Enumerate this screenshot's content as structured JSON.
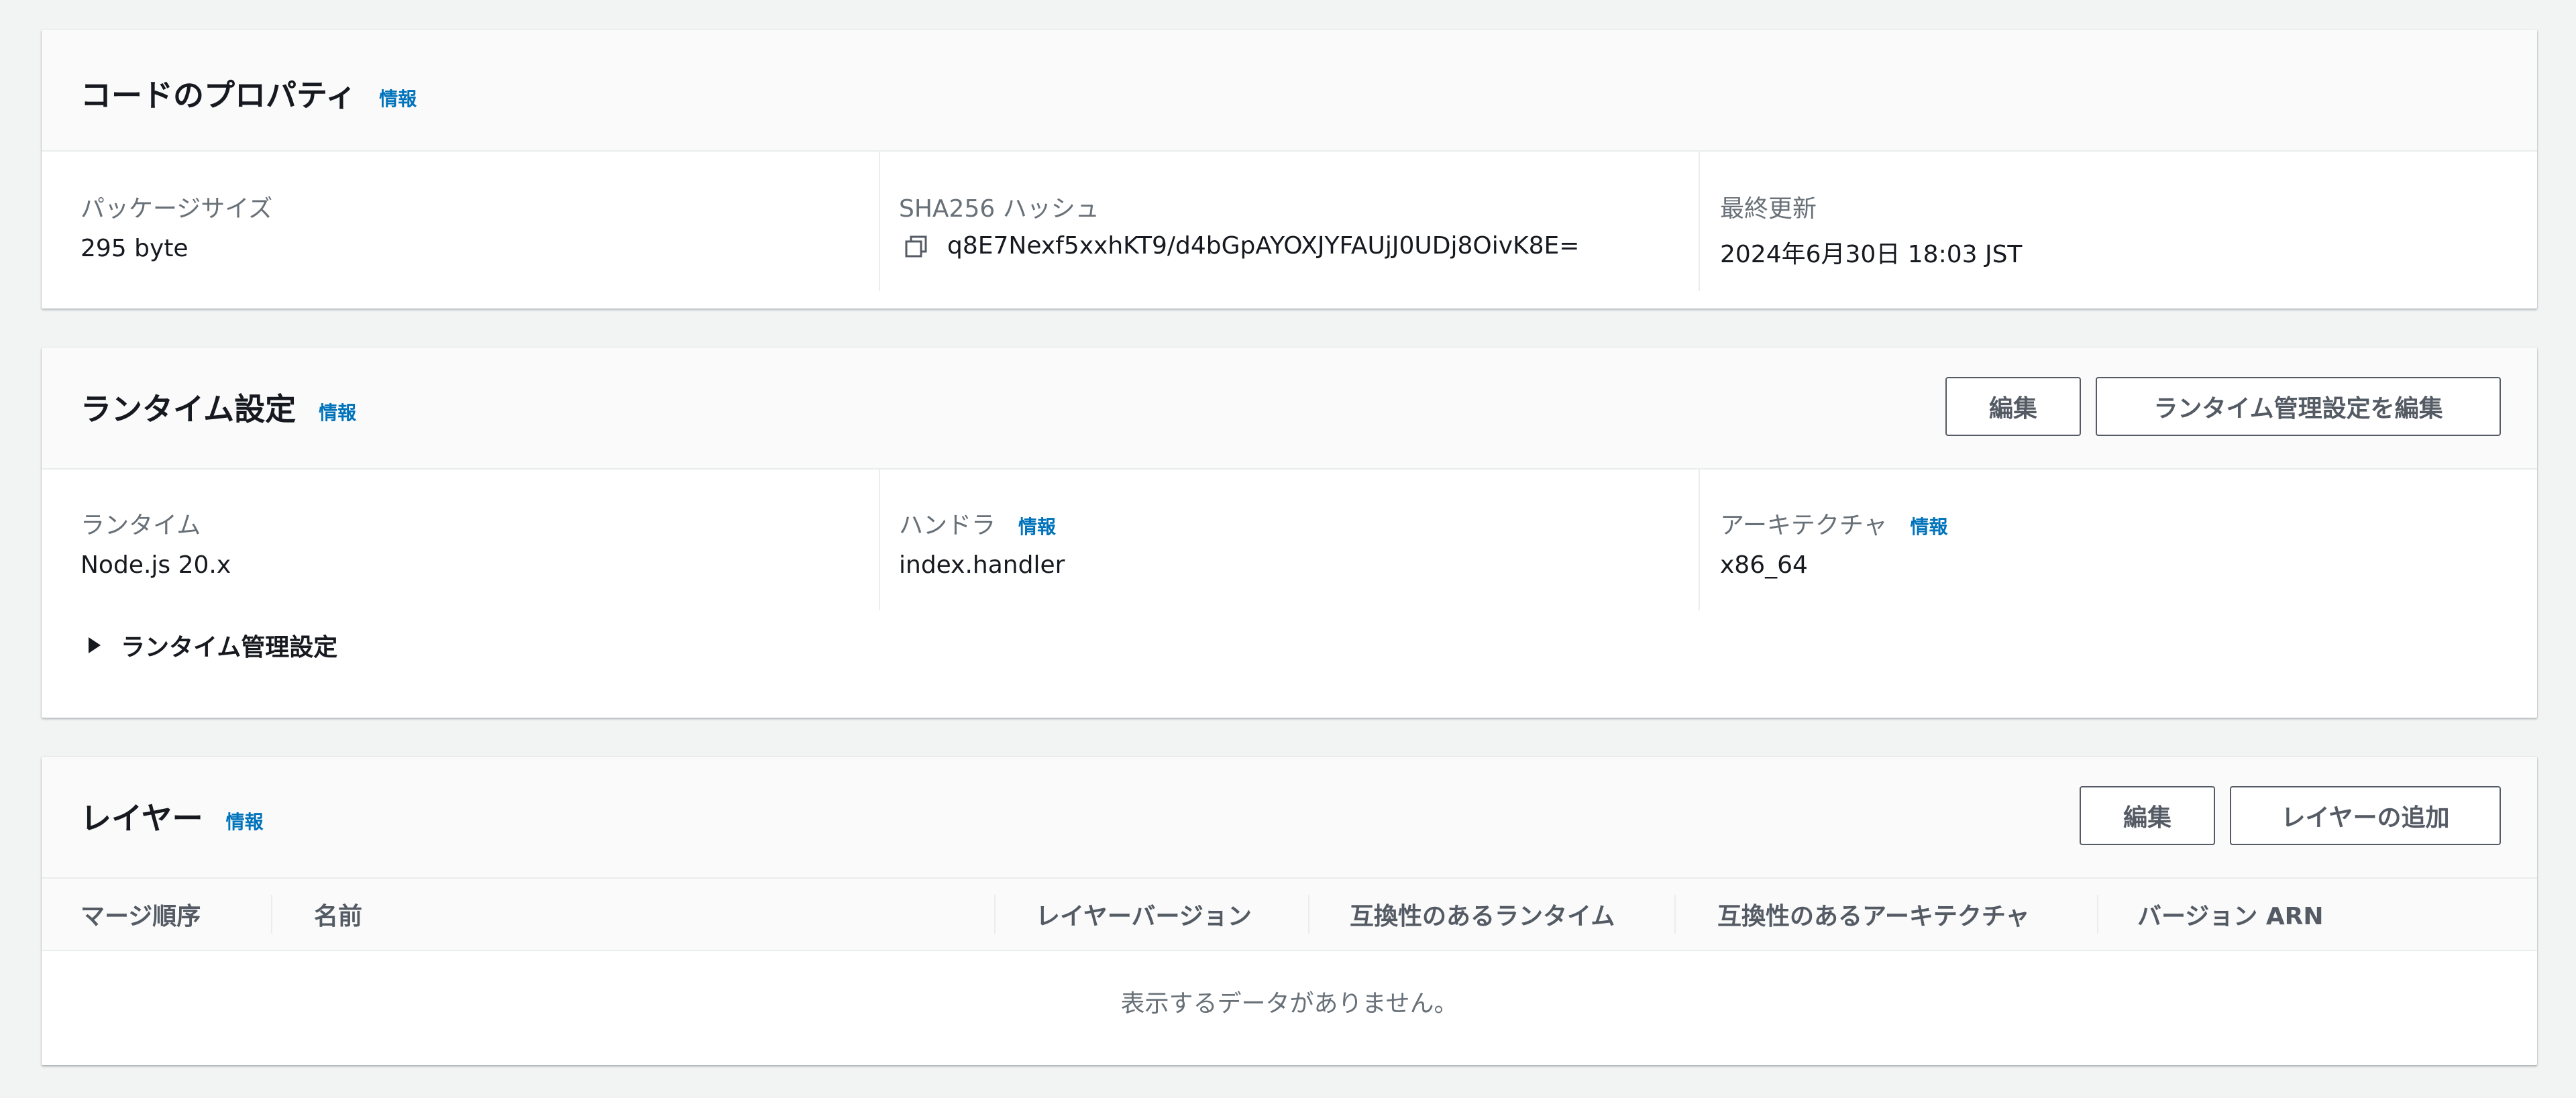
{
  "code_properties": {
    "title": "コードのプロパティ",
    "info": "情報",
    "package_size": {
      "label": "パッケージサイズ",
      "value": "295 byte"
    },
    "sha256": {
      "label": "SHA256 ハッシュ",
      "value": "q8E7Nexf5xxhKT9/d4bGpAYOXJYFAUjJ0UDj8OivK8E=",
      "icon": "copy-icon"
    },
    "last_modified": {
      "label": "最終更新",
      "value": "2024年6月30日 18:03 JST"
    }
  },
  "runtime_settings": {
    "title": "ランタイム設定",
    "info": "情報",
    "edit_button": "編集",
    "edit_runtime_mgmt_button": "ランタイム管理設定を編集",
    "runtime": {
      "label": "ランタイム",
      "value": "Node.js 20.x"
    },
    "handler": {
      "label": "ハンドラ",
      "info": "情報",
      "value": "index.handler"
    },
    "architecture": {
      "label": "アーキテクチャ",
      "info": "情報",
      "value": "x86_64"
    },
    "runtime_mgmt_expander": "ランタイム管理設定"
  },
  "layers": {
    "title": "レイヤー",
    "info": "情報",
    "edit_button": "編集",
    "add_layer_button": "レイヤーの追加",
    "columns": [
      "マージ順序",
      "名前",
      "レイヤーバージョン",
      "互換性のあるランタイム",
      "互換性のあるアーキテクチャ",
      "バージョン ARN"
    ],
    "empty_message": "表示するデータがありません。"
  },
  "colors": {
    "background": "#f2f3f3",
    "panel": "#ffffff",
    "panel_header": "#fafafa",
    "link": "#0073bb",
    "text": "#16191f",
    "secondary_text": "#687078",
    "button_border": "#545b64"
  }
}
